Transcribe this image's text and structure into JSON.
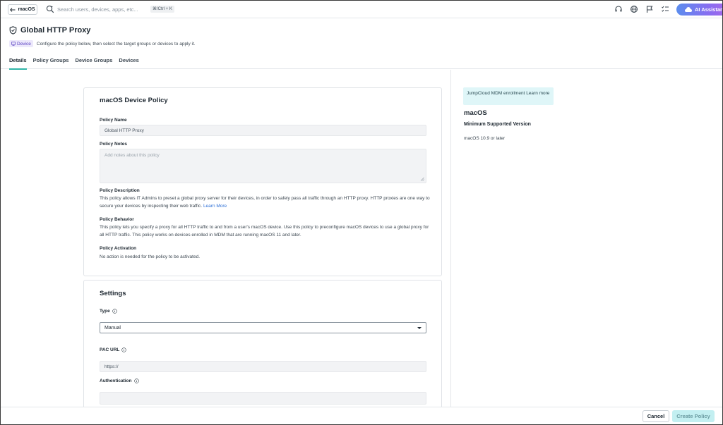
{
  "topbar": {
    "back_label": "macOS",
    "search_placeholder": "Search users, devices, apps, etc...",
    "search_shortcut": "⌘/Ctrl + K",
    "ai_label": "AI Assistant"
  },
  "header": {
    "title": "Global HTTP Proxy",
    "badge": "Device",
    "subtitle": "Configure the policy below, then select the target groups or devices to apply it."
  },
  "tabs": [
    {
      "label": "Details",
      "active": true
    },
    {
      "label": "Policy Groups",
      "active": false
    },
    {
      "label": "Device Groups",
      "active": false
    },
    {
      "label": "Devices",
      "active": false
    }
  ],
  "policy_card": {
    "title": "macOS Device Policy",
    "name_label": "Policy Name",
    "name_value": "Global HTTP Proxy",
    "notes_label": "Policy Notes",
    "notes_placeholder": "Add notes about this policy",
    "description_label": "Policy Description",
    "description_text": "This policy allows IT Admins to preset a global proxy server for their devices, in order to safely pass all traffic through an HTTP proxy. HTTP proxies are one way to secure your devices by inspecting their web traffic.",
    "description_link": "Learn More",
    "behavior_label": "Policy Behavior",
    "behavior_text": "This policy lets you specify a proxy for all HTTP traffic to and from a user's macOS device. Use this policy to preconfigure macOS devices to use a global proxy for all HTTP traffic. This policy works on devices enrolled in MDM that are running macOS 11 and later.",
    "activation_label": "Policy Activation",
    "activation_text": "No action is needed for the policy to be activated."
  },
  "settings_card": {
    "title": "Settings",
    "type_label": "Type",
    "type_value": "Manual",
    "pac_label": "PAC URL",
    "pac_placeholder": "https://",
    "auth_label": "Authentication",
    "auth_value": ""
  },
  "right_panel": {
    "mdm_note": "JumpCloud MDM enrollment",
    "mdm_link": "Learn more",
    "os_title": "macOS",
    "min_version_label": "Minimum Supported Version",
    "min_version_value": "macOS 10.9 or later"
  },
  "footer": {
    "cancel_label": "Cancel",
    "create_label": "Create Policy"
  }
}
